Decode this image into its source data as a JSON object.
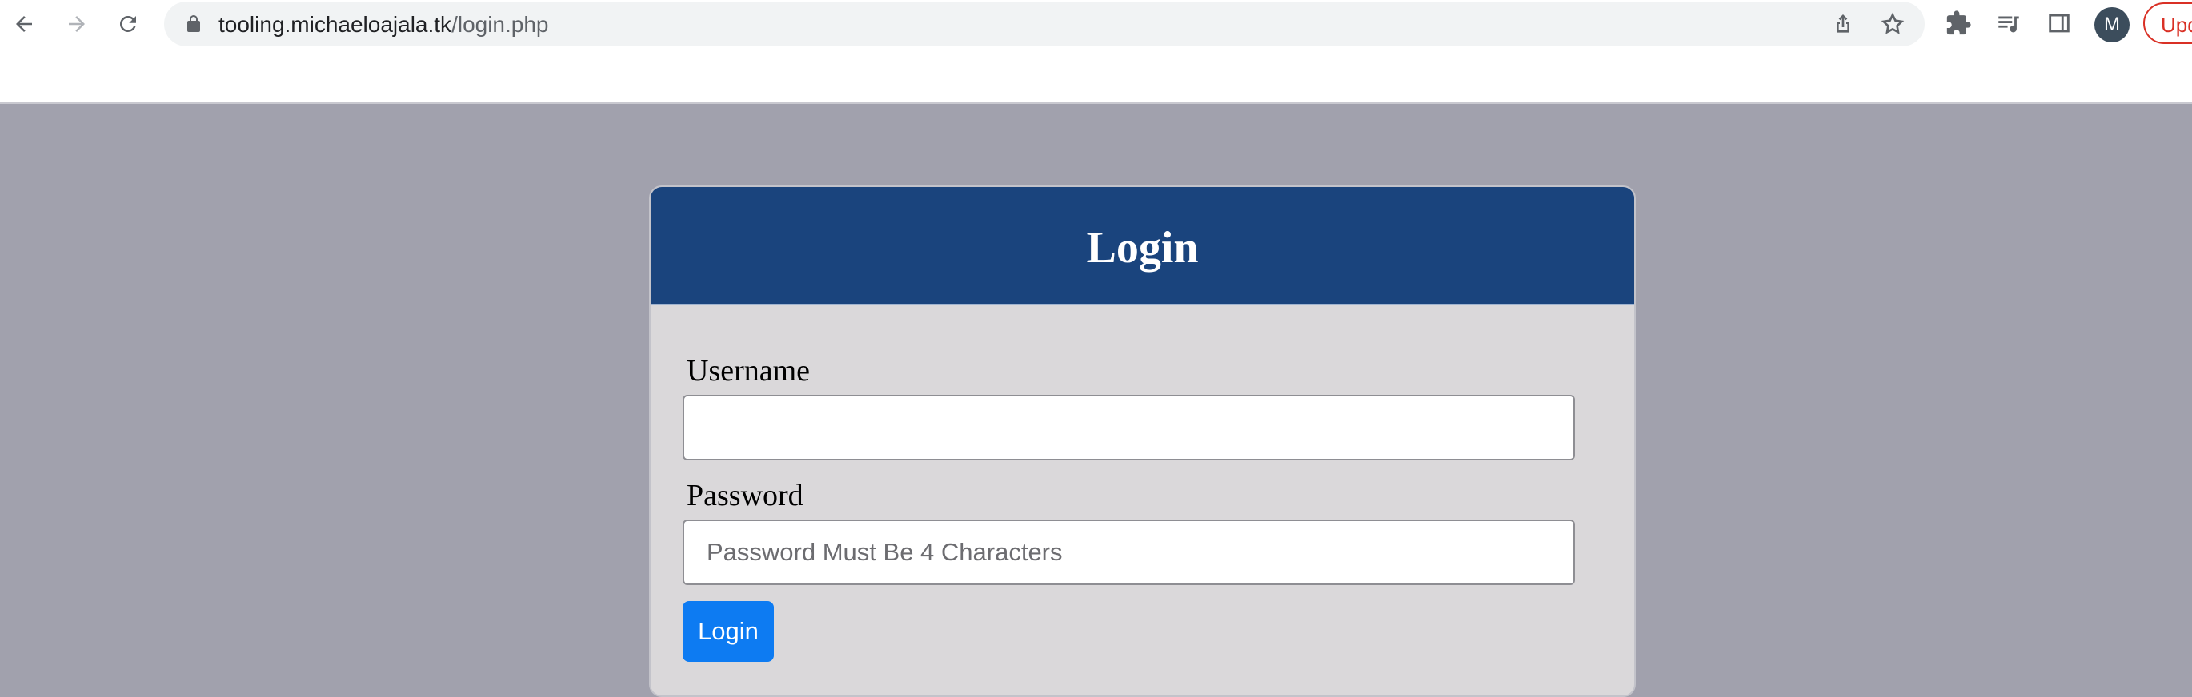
{
  "browser": {
    "url_host": "tooling.michaeloajala.tk",
    "url_path": "/login.php",
    "avatar_initial": "M",
    "update_label": "Update"
  },
  "login": {
    "title": "Login",
    "username_label": "Username",
    "username_value": "",
    "password_label": "Password",
    "password_placeholder": "Password Must Be 4 Characters",
    "submit_label": "Login"
  },
  "colors": {
    "page_background": "#a1a1ad",
    "header_background": "#1a447d",
    "card_background": "#dad8da",
    "button": "#0d7bf2",
    "update_accent": "#d93025"
  }
}
